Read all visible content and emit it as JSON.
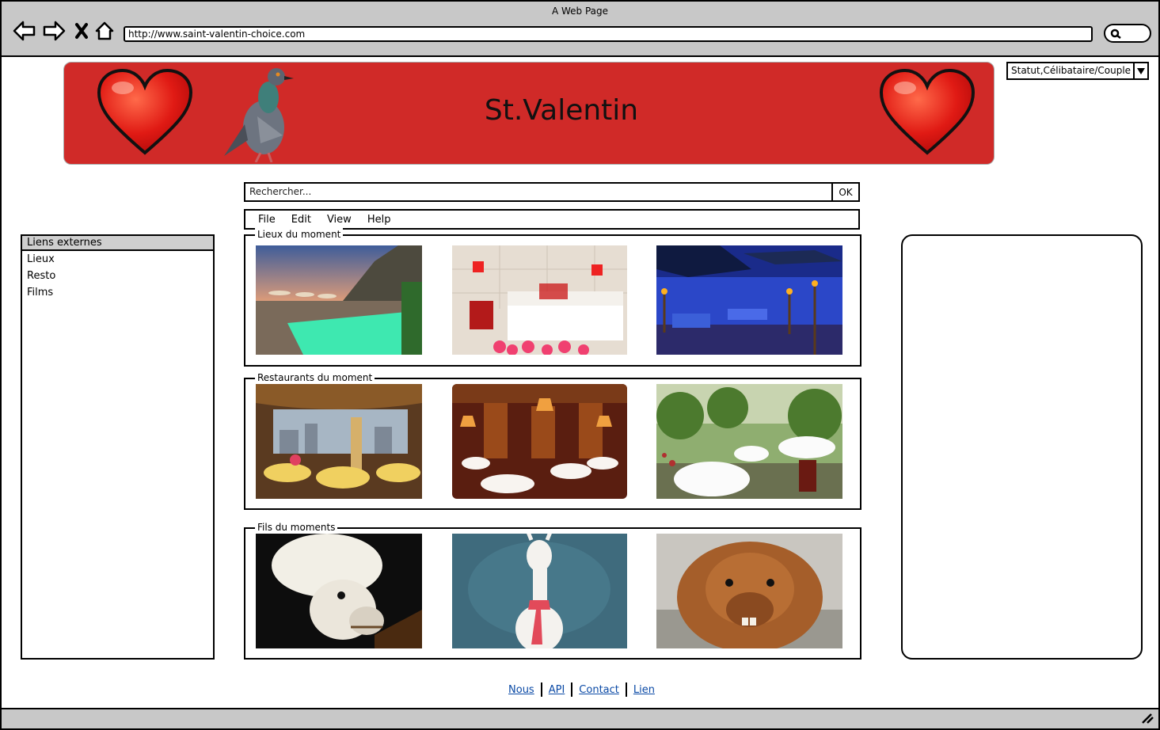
{
  "window": {
    "title": "A Web Page"
  },
  "browser": {
    "url": "http://www.saint-valentin-choice.com",
    "icons": [
      "back-icon",
      "forward-icon",
      "stop-icon",
      "home-icon",
      "search-icon"
    ]
  },
  "banner": {
    "title": "St.Valentin"
  },
  "status_select": {
    "value": "Statut,Célibataire/Couple"
  },
  "search": {
    "placeholder": "Rechercher...",
    "button": "OK"
  },
  "menubar": {
    "items": [
      "File",
      "Edit",
      "View",
      "Help"
    ]
  },
  "sidebar": {
    "header": "Liens externes",
    "items": [
      "Lieux",
      "Resto",
      "Films"
    ]
  },
  "groups": {
    "places": {
      "legend": "Lieux du moment"
    },
    "restaurants": {
      "legend": "Restaurants du moment"
    },
    "films": {
      "legend": "Fils du moments"
    }
  },
  "footer": {
    "links": [
      "Nous",
      "API",
      "Contact",
      "Lien"
    ]
  },
  "colors": {
    "banner": "#d02a28",
    "chrome": "#c8c8c8",
    "link": "#0b4aa6"
  }
}
